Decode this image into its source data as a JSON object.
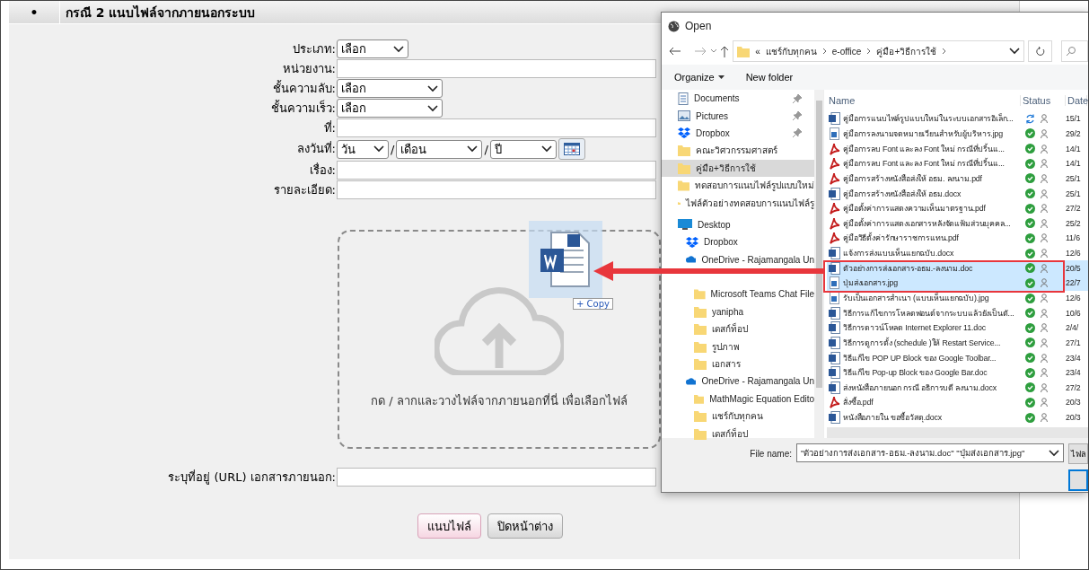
{
  "form_panel": {
    "bullet": "•",
    "title": "กรณี 2 แนบไฟล์จากภายนอกระบบ",
    "fields": [
      {
        "label": "ประเภท:",
        "kind": "select",
        "value": "เลือก"
      },
      {
        "label": "หน่วยงาน:",
        "kind": "text"
      },
      {
        "label": "ชั้นความลับ:",
        "kind": "select",
        "value": "เลือก"
      },
      {
        "label": "ชั้นความเร็ว:",
        "kind": "select",
        "value": "เลือก"
      },
      {
        "label": "ที่:",
        "kind": "text"
      },
      {
        "label": "ลงวันที่:",
        "kind": "date",
        "day": "วัน",
        "month": "เดือน",
        "year": "ปี",
        "separator": "/"
      },
      {
        "label": "เรื่อง:",
        "kind": "text"
      },
      {
        "label": "รายละเอียด:",
        "kind": "text"
      }
    ],
    "dropzone": {
      "text": "กด / ลากและวางไฟล์จากภายนอกที่นี่ เพื่อเลือกไฟล์"
    },
    "url_field": {
      "label": "ระบุที่อยู่ (URL) เอกสารภายนอก:"
    },
    "buttons": [
      {
        "label": "แนบไฟล์",
        "kind": "primary"
      },
      {
        "label": "ปิดหน้าต่าง",
        "kind": "secondary"
      }
    ]
  },
  "drag_ghost": {
    "badge": "+ Copy"
  },
  "dialog": {
    "title": "Open",
    "breadcrumb": {
      "overflow": "«",
      "items": [
        "แชร์กับทุกคน",
        "e-office",
        "คู่มือ+วิธีการใช้"
      ]
    },
    "toolbar": [
      {
        "label": "Organize",
        "menu": true
      },
      {
        "label": "New folder",
        "menu": false
      }
    ],
    "nav": [
      {
        "label": "Documents",
        "kind": "document",
        "pinned": true,
        "selected": false
      },
      {
        "label": "Pictures",
        "kind": "pictures",
        "pinned": true,
        "selected": false
      },
      {
        "label": "Dropbox",
        "kind": "dropbox",
        "pinned": true,
        "selected": false
      },
      {
        "label": "คณะวิศวกรรมศาสตร์",
        "kind": "folder",
        "pinned": false,
        "selected": false
      },
      {
        "label": "คู่มือ+วิธีการใช้",
        "kind": "folder",
        "pinned": false,
        "selected": true
      },
      {
        "label": "ทดสอบการแนบไฟล์รูปแบบใหม่",
        "kind": "folder",
        "pinned": false,
        "selected": false
      },
      {
        "label": "ไฟล์ตัวอย่างทดสอบการแนบไฟล์รู",
        "kind": "folder",
        "pinned": false,
        "selected": false
      },
      {
        "label": "Desktop",
        "kind": "desktop",
        "pinned": false,
        "selected": false,
        "children": [
          {
            "label": "Dropbox",
            "kind": "dropbox",
            "pinned": false,
            "selected": false
          },
          {
            "label": "OneDrive - Rajamangala Un",
            "kind": "cloud",
            "pinned": false,
            "selected": false,
            "children": [
              {
                "label": "Microsoft Teams Chat File",
                "kind": "folder",
                "pinned": false,
                "selected": false
              },
              {
                "label": "yanipha",
                "kind": "folder",
                "pinned": false,
                "selected": false
              },
              {
                "label": "เดสก์ท็อป",
                "kind": "folder",
                "pinned": false,
                "selected": false
              },
              {
                "label": "รูปภาพ",
                "kind": "folder",
                "pinned": false,
                "selected": false
              },
              {
                "label": "เอกสาร",
                "kind": "folder",
                "pinned": false,
                "selected": false
              }
            ]
          },
          {
            "label": "OneDrive - Rajamangala Un",
            "kind": "cloud",
            "pinned": false,
            "selected": false,
            "children": [
              {
                "label": "MathMagic Equation Edito",
                "kind": "folder",
                "pinned": false,
                "selected": false
              },
              {
                "label": "แชร์กับทุกคน",
                "kind": "folder",
                "pinned": false,
                "selected": false
              },
              {
                "label": "เดสก์ท็อป",
                "kind": "folder",
                "pinned": false,
                "selected": false
              }
            ]
          }
        ]
      }
    ],
    "columns": [
      "Name",
      "Status",
      "Date"
    ],
    "files": [
      {
        "name": "คู่มือการแนบไฟล์รูปแบบใหม่ในระบบเอกสารอิเล็ก...",
        "kind": "word",
        "synced": false,
        "date": "15/1",
        "selected": false
      },
      {
        "name": "คู่มือการลงนามจดหมายเวียนสำหรับผู้บริหาร.jpg",
        "kind": "image",
        "synced": true,
        "date": "29/2",
        "selected": false
      },
      {
        "name": "คู่มือการลบ Font และลง Font ใหม่ กรณีที่ปริ้นแ...",
        "kind": "pdf",
        "synced": true,
        "date": "14/1",
        "selected": false
      },
      {
        "name": "คู่มือการลบ Font และลง Font ใหม่ กรณีที่ปริ้นแ...",
        "kind": "pdf",
        "synced": true,
        "date": "14/1",
        "selected": false
      },
      {
        "name": "คู่มือการสร้างหนังสือส่งให้ อธม. ลงนาม.pdf",
        "kind": "pdf",
        "synced": true,
        "date": "25/1",
        "selected": false
      },
      {
        "name": "คู่มือการสร้างหนังสือส่งให้ อธม.docx",
        "kind": "word",
        "synced": true,
        "date": "25/1",
        "selected": false
      },
      {
        "name": "คู่มือตั้งค่าการแสดงความเห็นมาตรฐาน.pdf",
        "kind": "pdf",
        "synced": true,
        "date": "27/2",
        "selected": false
      },
      {
        "name": "คู่มือตั้งค่าการแสดงเอกสารหลังจัดแฟ้มส่วนบุคคล...",
        "kind": "pdf",
        "synced": true,
        "date": "25/2",
        "selected": false
      },
      {
        "name": "คู่มือวิธีตั้งค่ารักษาราชการแทน.pdf",
        "kind": "pdf",
        "synced": true,
        "date": "11/6",
        "selected": false
      },
      {
        "name": "แจ้งการส่งแบบเห็นแยกฉบับ.docx",
        "kind": "word",
        "synced": true,
        "date": "12/6",
        "selected": false
      },
      {
        "name": "ตัวอย่างการส่งเอกสาร-อธม.-ลงนาม.doc",
        "kind": "word",
        "synced": true,
        "date": "20/5",
        "selected": true
      },
      {
        "name": "ปุ่มส่งเอกสาร.jpg",
        "kind": "image",
        "synced": true,
        "date": "22/7",
        "selected": true
      },
      {
        "name": "รับเป็นเอกสารสำเนา (แบบเห็นแยกฉบับ).jpg",
        "kind": "image",
        "synced": true,
        "date": "12/6",
        "selected": false
      },
      {
        "name": "วิธีการแก้ไขการโหลดฟอนต์จากระบบแล้วยังเป็นตั...",
        "kind": "word",
        "synced": true,
        "date": "10/6",
        "selected": false
      },
      {
        "name": "วิธีการดาวน์โหลด Internet Explorer 11.doc",
        "kind": "word",
        "synced": true,
        "date": "2/4/",
        "selected": false
      },
      {
        "name": "วิธีการดูการตั้ง (schedule )ให้ Restart Service...",
        "kind": "word",
        "synced": true,
        "date": "27/1",
        "selected": false
      },
      {
        "name": "วิธีแก้ไข POP UP Block ของ Google Toolbar...",
        "kind": "word",
        "synced": true,
        "date": "23/4",
        "selected": false
      },
      {
        "name": "วิธีแก้ไข Pop-up Block ของ Google Bar.doc",
        "kind": "word",
        "synced": true,
        "date": "23/4",
        "selected": false
      },
      {
        "name": "ส่งหนังสือภายนอก กรณี อธิการบดี ลงนาม.docx",
        "kind": "word",
        "synced": true,
        "date": "27/2",
        "selected": false
      },
      {
        "name": "สั่งซื้อ.pdf",
        "kind": "pdf",
        "synced": true,
        "date": "20/3",
        "selected": false
      },
      {
        "name": "หนังสือภายใน ขอซื้อวัสดุ.docx",
        "kind": "word",
        "synced": true,
        "date": "20/3",
        "selected": false
      }
    ],
    "file_name": {
      "label": "File name:",
      "value": "\"ตัวอย่างการส่งเอกสาร-อธม.-ลงนาม.doc\" \"ปุ่มส่งเอกสาร.jpg\""
    },
    "filter_button": "ไฟล"
  }
}
